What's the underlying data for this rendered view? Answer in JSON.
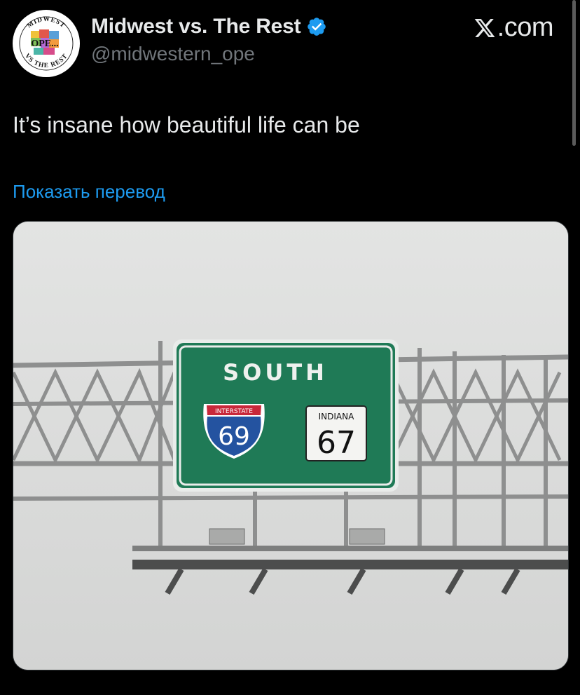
{
  "account": {
    "display_name": "Midwest vs. The Rest",
    "handle": "@midwestern_ope",
    "verified": true,
    "avatar": {
      "top_text": "MIDWEST",
      "center_text": "OPE...",
      "bottom_text": "VS THE REST"
    }
  },
  "brand": {
    "label": ".com",
    "icon": "x-logo-icon"
  },
  "tweet": {
    "text": "It’s insane how beautiful life can be",
    "translate_label": "Показать перевод"
  },
  "media": {
    "sign": {
      "direction": "SOUTH",
      "interstate_banner": "INTERSTATE",
      "interstate_number": "69",
      "state_banner": "INDIANA",
      "state_number": "67"
    }
  },
  "colors": {
    "background": "#000000",
    "text": "#e7e9ea",
    "secondary_text": "#71767b",
    "link": "#1d9bf0",
    "verified": "#1d9bf0",
    "sign_green": "#1f7a56"
  }
}
